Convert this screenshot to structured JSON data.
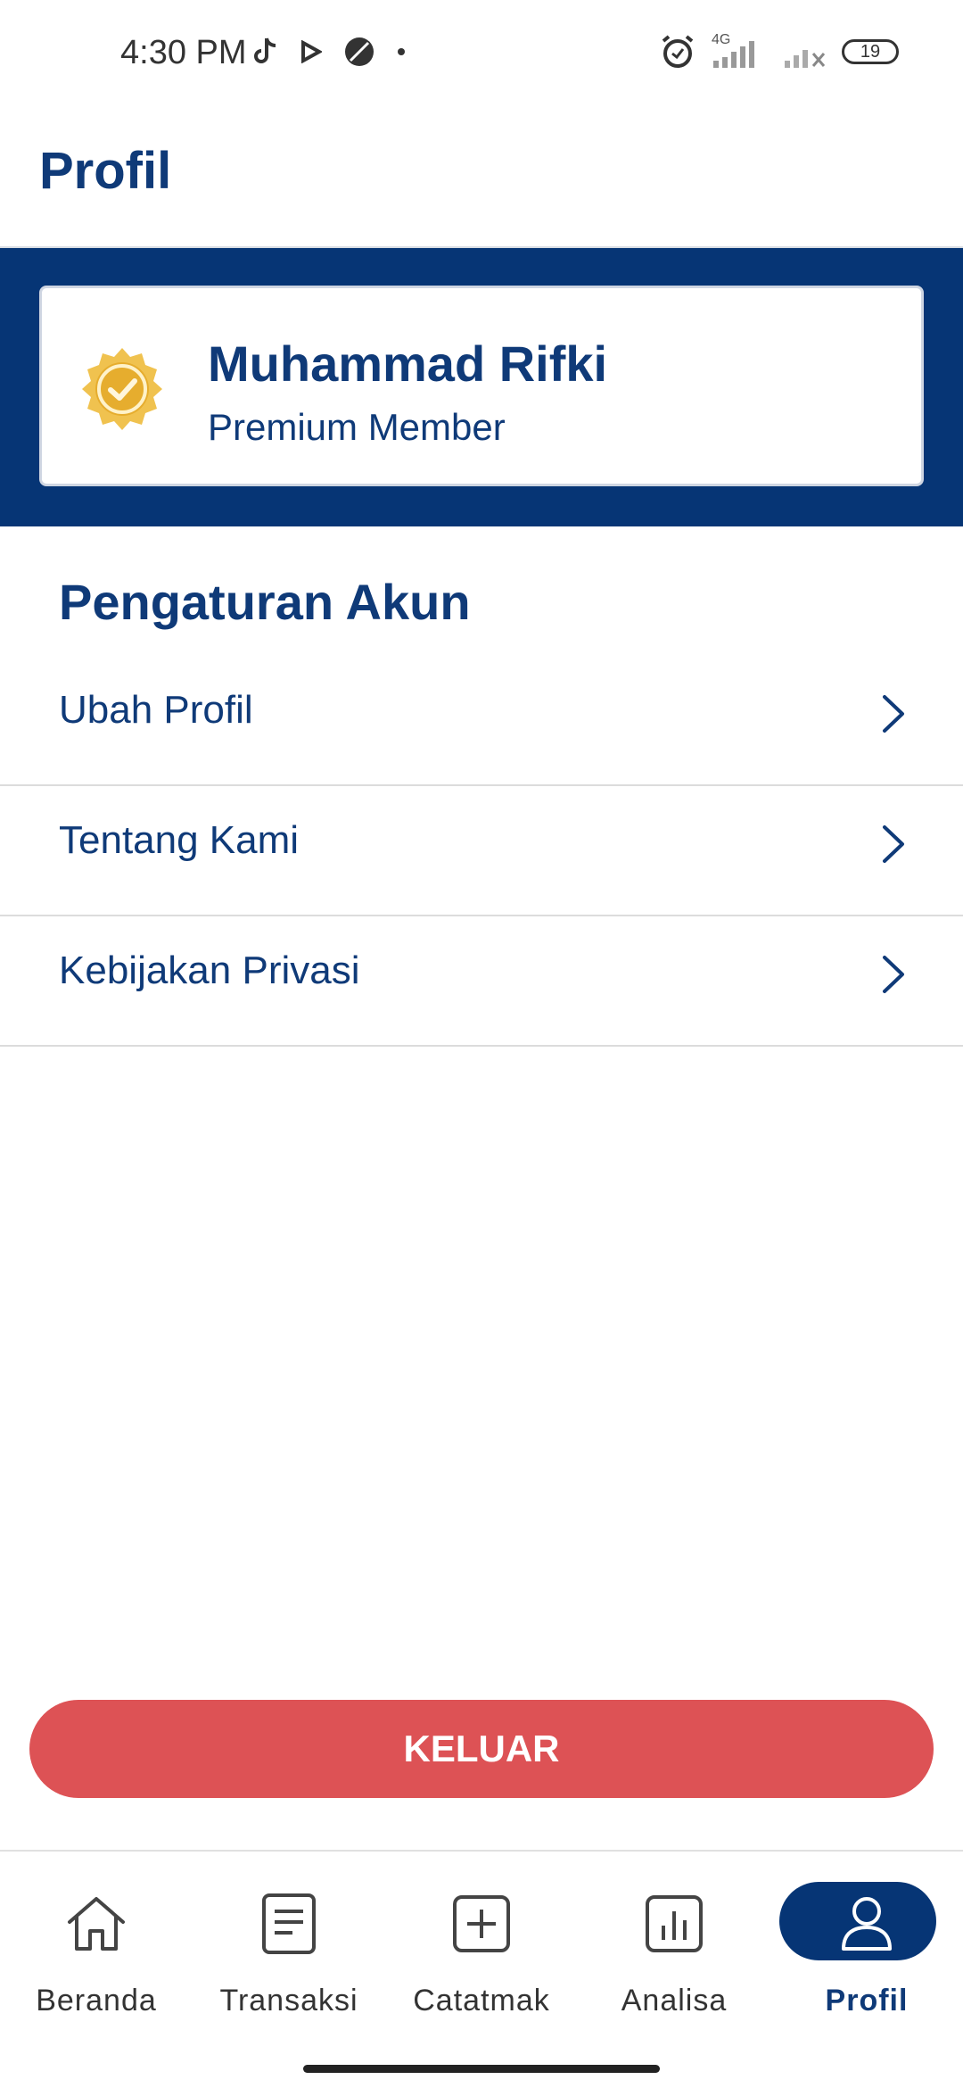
{
  "status_bar": {
    "time": "4:30 PM",
    "network": "4G",
    "battery": "19",
    "icons": [
      "tiktok-icon",
      "play-icon",
      "no-signal-icon",
      "dot-icon",
      "alarm-icon",
      "signal-icon",
      "signal-off-icon",
      "battery-icon"
    ]
  },
  "header": {
    "title": "Profil"
  },
  "profile": {
    "name": "Muhammad Rifki",
    "membership": "Premium Member",
    "badge_icon": "verified-badge-icon"
  },
  "settings": {
    "title": "Pengaturan Akun",
    "items": [
      {
        "label": "Ubah Profil"
      },
      {
        "label": "Tentang Kami"
      },
      {
        "label": "Kebijakan Privasi"
      }
    ]
  },
  "logout": {
    "label": "KELUAR"
  },
  "bottom_nav": {
    "items": [
      {
        "label": "Beranda",
        "icon": "home-icon"
      },
      {
        "label": "Transaksi",
        "icon": "document-icon"
      },
      {
        "label": "Catatmak",
        "icon": "add-box-icon"
      },
      {
        "label": "Analisa",
        "icon": "chart-icon"
      },
      {
        "label": "Profil",
        "icon": "user-icon",
        "active": true
      }
    ]
  },
  "colors": {
    "primary": "#063575",
    "text_primary": "#0f3a78",
    "danger": "#dd5255",
    "badge_gold": "#f2c14e"
  }
}
